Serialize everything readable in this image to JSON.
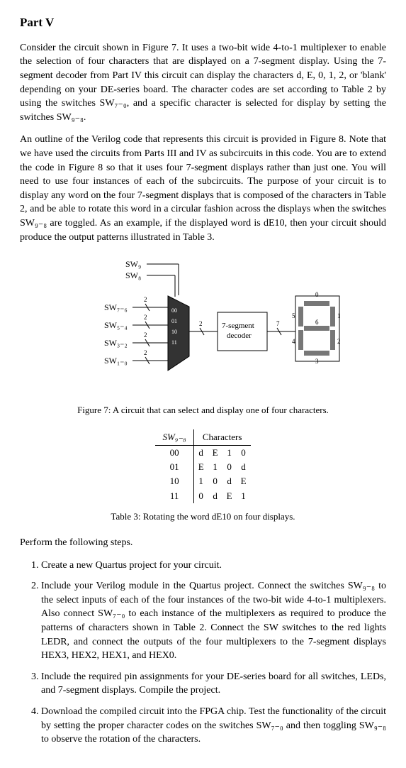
{
  "title": "Part V",
  "para1": "Consider the circuit shown in Figure 7. It uses a two-bit wide 4-to-1 multiplexer to enable the selection of four characters that are displayed on a 7-segment display. Using the 7-segment decoder from Part IV this circuit can display the characters d, E, 0, 1, 2, or 'blank' depending on your DE-series board. The character codes are set according to Table 2 by using the switches SW₇₋₀, and a specific character is selected for display by setting the switches SW₉₋₈.",
  "para2": "An outline of the Verilog code that represents this circuit is provided in Figure 8. Note that we have used the circuits from Parts III and IV as subcircuits in this code. You are to extend the code in Figure 8 so that it uses four 7-segment displays rather than just one. You will need to use four instances of each of the subcircuits. The purpose of your circuit is to display any word on the four 7-segment displays that is composed of the characters in Table 2, and be able to rotate this word in a circular fashion across the displays when the switches SW₉₋₈ are toggled. As an example, if the displayed word is dE10, then your circuit should produce the output patterns illustrated in Table 3.",
  "figure": {
    "labels": {
      "sw9": "SW₉",
      "sw8": "SW₈",
      "sw76": "SW₇₋₆",
      "sw54": "SW₅₋₄",
      "sw32": "SW₃₋₂",
      "sw10": "SW₁₋₀",
      "mux00": "00",
      "mux01": "01",
      "mux10": "10",
      "mux11": "11",
      "decoder": "7-segment\ndecoder",
      "bus2a": "2",
      "bus2b": "2",
      "bus2c": "2",
      "bus2d": "2",
      "bus2e": "2",
      "bus7": "7",
      "seg0": "0",
      "seg1": "1",
      "seg2": "2",
      "seg3": "3",
      "seg4": "4",
      "seg5": "5",
      "seg6": "6"
    },
    "caption": "Figure 7: A circuit that can select and display one of four characters."
  },
  "table3": {
    "header_left": "SW₉₋₈",
    "header_right": "Characters",
    "rows": [
      {
        "key": "00",
        "cells": [
          "d",
          "E",
          "1",
          "0"
        ]
      },
      {
        "key": "01",
        "cells": [
          "E",
          "1",
          "0",
          "d"
        ]
      },
      {
        "key": "10",
        "cells": [
          "1",
          "0",
          "d",
          "E"
        ]
      },
      {
        "key": "11",
        "cells": [
          "0",
          "d",
          "E",
          "1"
        ]
      }
    ],
    "caption": "Table 3: Rotating the word dE10 on four displays."
  },
  "steps_intro": "Perform the following steps.",
  "steps": [
    "Create a new Quartus project for your circuit.",
    "Include your Verilog module in the Quartus project. Connect the switches SW₉₋₈ to the select inputs of each of the four instances of the two-bit wide 4-to-1 multiplexers. Also connect SW₇₋₀ to each instance of the multiplexers as required to produce the patterns of characters shown in Table 2. Connect the SW switches to the red lights LEDR, and connect the outputs of the four multiplexers to the 7-segment displays HEX3, HEX2, HEX1, and HEX0.",
    "Include the required pin assignments for your DE-series board for all switches, LEDs, and 7-segment displays. Compile the project.",
    "Download the compiled circuit into the FPGA chip. Test the functionality of the circuit by setting the proper character codes on the switches SW₇₋₀ and then toggling SW₉₋₈ to observe the rotation of the characters."
  ]
}
